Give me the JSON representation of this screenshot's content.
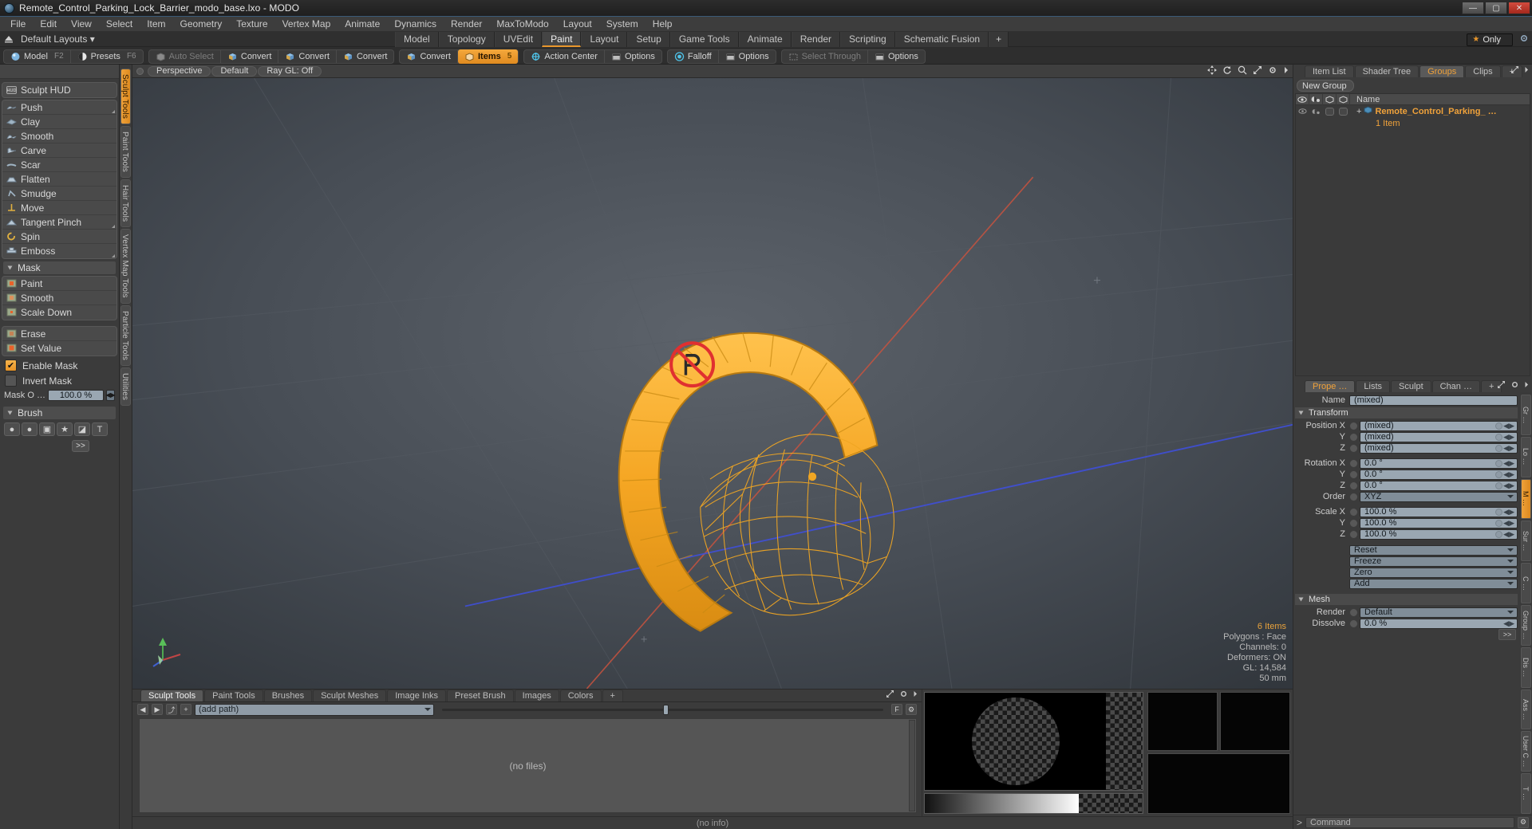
{
  "window": {
    "title": "Remote_Control_Parking_Lock_Barrier_modo_base.lxo - MODO",
    "minimize": "—",
    "maximize": "▢",
    "close": "✕"
  },
  "menu": {
    "items": [
      "File",
      "Edit",
      "View",
      "Select",
      "Item",
      "Geometry",
      "Texture",
      "Vertex Map",
      "Animate",
      "Dynamics",
      "Render",
      "MaxToModo",
      "Layout",
      "System",
      "Help"
    ]
  },
  "layout_bar": {
    "default_layouts": "Default Layouts ▾",
    "tabs": [
      {
        "label": "Model",
        "active": false
      },
      {
        "label": "Topology",
        "active": false
      },
      {
        "label": "UVEdit",
        "active": false
      },
      {
        "label": "Paint",
        "active": true
      },
      {
        "label": "Layout",
        "active": false
      },
      {
        "label": "Setup",
        "active": false
      },
      {
        "label": "Game Tools",
        "active": false
      },
      {
        "label": "Animate",
        "active": false
      },
      {
        "label": "Render",
        "active": false
      },
      {
        "label": "Scripting",
        "active": false
      },
      {
        "label": "Schematic Fusion",
        "active": false
      }
    ],
    "add_tab": "+",
    "only_label": "Only",
    "star": "★"
  },
  "mode_toolbar": {
    "group1": [
      {
        "label": "Model",
        "hotkey": "F2",
        "icon": "sphere-icon",
        "state": "normal"
      },
      {
        "label": "Presets",
        "hotkey": "F6",
        "icon": "presets-icon",
        "state": "normal"
      }
    ],
    "group2": [
      {
        "label": "Auto Select",
        "hotkey": "",
        "icon": "box-icon",
        "state": "dim"
      },
      {
        "label": "Convert",
        "hotkey": "",
        "icon": "convert-icon",
        "state": "normal"
      },
      {
        "label": "Convert",
        "hotkey": "",
        "icon": "convert-icon",
        "state": "normal"
      },
      {
        "label": "Convert",
        "hotkey": "",
        "icon": "convert-icon",
        "state": "normal"
      }
    ],
    "group3": [
      {
        "label": "Convert",
        "hotkey": "",
        "icon": "convert-icon",
        "state": "normal"
      },
      {
        "label": "Items",
        "hotkey": "5",
        "icon": "items-icon",
        "state": "on"
      }
    ],
    "group4": [
      {
        "label": "Action Center",
        "hotkey": "",
        "icon": "action-center-icon",
        "state": "normal"
      },
      {
        "label": "Options",
        "hotkey": "",
        "icon": "options-icon",
        "state": "normal"
      }
    ],
    "group5": [
      {
        "label": "Falloff",
        "hotkey": "",
        "icon": "falloff-icon",
        "state": "normal"
      },
      {
        "label": "Options",
        "hotkey": "",
        "icon": "options-icon",
        "state": "normal"
      }
    ],
    "group6": [
      {
        "label": "Select Through",
        "hotkey": "",
        "icon": "select-through-icon",
        "state": "dim"
      },
      {
        "label": "Options",
        "hotkey": "",
        "icon": "options-icon",
        "state": "normal"
      }
    ]
  },
  "left_panel": {
    "sculpt_hud": {
      "label": "Sculpt HUD",
      "icon": "hud-icon"
    },
    "sculpt_tools": [
      {
        "label": "Push",
        "icon": "push-icon",
        "has_corner": true
      },
      {
        "label": "Clay",
        "icon": "clay-icon",
        "has_corner": false
      },
      {
        "label": "Smooth",
        "icon": "smooth-icon",
        "has_corner": false
      },
      {
        "label": "Carve",
        "icon": "carve-icon",
        "has_corner": false
      },
      {
        "label": "Scar",
        "icon": "scar-icon",
        "has_corner": false
      },
      {
        "label": "Flatten",
        "icon": "flatten-icon",
        "has_corner": false
      },
      {
        "label": "Smudge",
        "icon": "smudge-icon",
        "has_corner": false
      },
      {
        "label": "Move",
        "icon": "move-icon",
        "has_corner": false
      },
      {
        "label": "Tangent Pinch",
        "icon": "tangent-pinch-icon",
        "has_corner": true
      },
      {
        "label": "Spin",
        "icon": "spin-icon",
        "has_corner": false
      },
      {
        "label": "Emboss",
        "icon": "emboss-icon",
        "has_corner": true
      }
    ],
    "mask_section_title": "Mask",
    "mask_tools_a": [
      {
        "label": "Paint",
        "icon": "mask-paint-icon"
      },
      {
        "label": "Smooth",
        "icon": "mask-smooth-icon"
      },
      {
        "label": "Scale Down",
        "icon": "mask-scale-down-icon"
      }
    ],
    "mask_tools_b": [
      {
        "label": "Erase",
        "icon": "mask-erase-icon"
      },
      {
        "label": "Set Value",
        "icon": "mask-set-value-icon"
      }
    ],
    "enable_mask": {
      "label": "Enable Mask",
      "checked": true,
      "check_glyph": "✔"
    },
    "invert_mask": {
      "label": "Invert Mask",
      "checked": false,
      "check_glyph": ""
    },
    "mask_opacity": {
      "label": "Mask O  …",
      "value": "100.0 %"
    },
    "brush_section_title": "Brush",
    "brush_buttons": [
      "●",
      "●",
      "▣",
      "★",
      "◪",
      "T"
    ],
    "more_button": ">>",
    "vertical_tabs": [
      {
        "label": "Sculpt Tools",
        "active": true
      },
      {
        "label": "Paint Tools",
        "active": false
      },
      {
        "label": "Hair Tools",
        "active": false
      },
      {
        "label": "Vertex Map Tools",
        "active": false
      },
      {
        "label": "Particle Tools",
        "active": false
      },
      {
        "label": "Utilities",
        "active": false
      }
    ]
  },
  "viewport": {
    "header": {
      "perspective": "Perspective",
      "shading": "Default",
      "raygl": "Ray GL: Off",
      "icons": [
        "move-icon",
        "rotate-icon",
        "zoom-icon",
        "expand-icon",
        "gear-icon",
        "chevron-right-icon"
      ]
    },
    "stats": [
      {
        "text": "6 Items",
        "highlight": true
      },
      {
        "text": "Polygons : Face",
        "highlight": false
      },
      {
        "text": "Channels: 0",
        "highlight": false
      },
      {
        "text": "Deformers: ON",
        "highlight": false
      },
      {
        "text": "GL: 14,584",
        "highlight": false
      },
      {
        "text": "50 mm",
        "highlight": false
      }
    ],
    "model_color": "#f5a623",
    "sign_color": "#e03030"
  },
  "bottom_panel": {
    "tabs": [
      {
        "label": "Sculpt Tools",
        "active": true
      },
      {
        "label": "Paint Tools",
        "active": false
      },
      {
        "label": "Brushes",
        "active": false
      },
      {
        "label": "Sculpt Meshes",
        "active": false
      },
      {
        "label": "Image Inks",
        "active": false
      },
      {
        "label": "Preset Brush",
        "active": false
      },
      {
        "label": "Images",
        "active": false
      },
      {
        "label": "Colors",
        "active": false
      },
      {
        "label": "+",
        "active": false
      }
    ],
    "nav_buttons": [
      "◀",
      "▶",
      "⤴",
      "+"
    ],
    "path_value": "(add path)",
    "filter_button": "F",
    "gear_button": "⚙",
    "file_area_text": "(no files)",
    "status": "(no info)"
  },
  "right_panel": {
    "top_tabs": [
      {
        "label": "Item List",
        "active": false
      },
      {
        "label": "Shader Tree",
        "active": false
      },
      {
        "label": "Groups",
        "active": true
      },
      {
        "label": "Clips",
        "active": false
      },
      {
        "label": "+",
        "active": false
      }
    ],
    "new_group_button": "New Group",
    "list_header": {
      "name": "Name",
      "cols": [
        "eye-icon",
        "render-icon",
        "cube-icon",
        "cube2-icon"
      ]
    },
    "group_row": {
      "expand": "+",
      "name": "Remote_Control_Parking_ …",
      "sub": "1 Item",
      "icon": "group-icon"
    },
    "prop_tabs": [
      {
        "label": "Prope …",
        "active": true
      },
      {
        "label": "Lists",
        "active": false
      },
      {
        "label": "Sculpt",
        "active": false
      },
      {
        "label": "Chan …",
        "active": false
      },
      {
        "label": "+",
        "active": false
      }
    ],
    "name_label": "Name",
    "name_value": "(mixed)",
    "transform_title": "Transform",
    "transform_rows": [
      {
        "label": "Position X",
        "value": "(mixed)"
      },
      {
        "label": "Y",
        "value": "(mixed)"
      },
      {
        "label": "Z",
        "value": "(mixed)"
      },
      {
        "label": "Rotation X",
        "value": "0.0 °"
      },
      {
        "label": "Y",
        "value": "0.0 °"
      },
      {
        "label": "Z",
        "value": "0.0 °"
      }
    ],
    "order": {
      "label": "Order",
      "value": "XYZ"
    },
    "scale_rows": [
      {
        "label": "Scale X",
        "value": "100.0 %"
      },
      {
        "label": "Y",
        "value": "100.0 %"
      },
      {
        "label": "Z",
        "value": "100.0 %"
      }
    ],
    "actions": [
      "Reset",
      "Freeze",
      "Zero",
      "Add"
    ],
    "mesh_title": "Mesh",
    "mesh_rows": [
      {
        "label": "Render",
        "value": "Default",
        "type": "drop"
      },
      {
        "label": "Dissolve",
        "value": "0.0 %",
        "type": "num"
      }
    ],
    "more_btn": ">>",
    "side_tabs": [
      {
        "label": "Gr …",
        "active": false
      },
      {
        "label": "Lo …",
        "active": false
      },
      {
        "label": "M …",
        "active": true
      },
      {
        "label": "Sur …",
        "active": false
      },
      {
        "label": "C …",
        "active": false
      },
      {
        "label": "Group …",
        "active": false
      },
      {
        "label": "Dis …",
        "active": false
      },
      {
        "label": "Ass …",
        "active": false
      },
      {
        "label": "User C …",
        "active": false
      },
      {
        "label": "T …",
        "active": false
      }
    ],
    "command_prompt": ">",
    "command_placeholder": "Command",
    "command_gear": "⚙"
  }
}
